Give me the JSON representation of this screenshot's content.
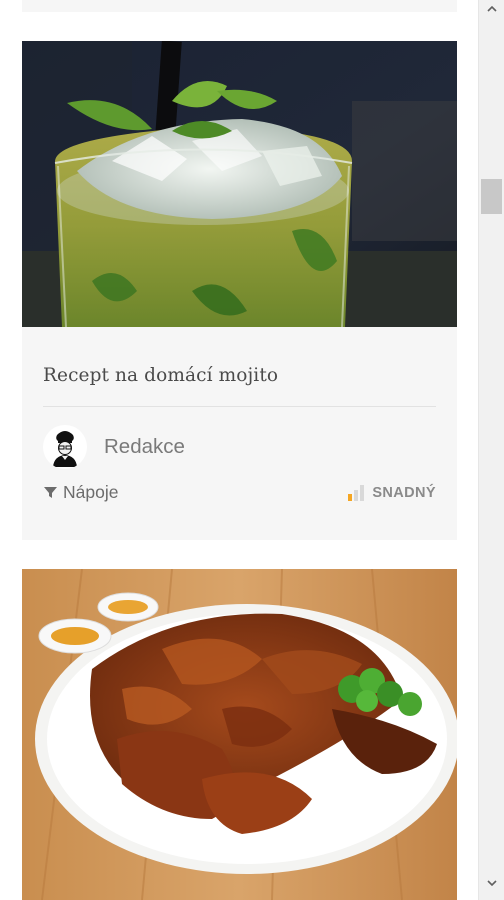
{
  "cards": [
    {
      "title": "Recept na domácí mojito",
      "author": "Redakce",
      "category": "Nápoje",
      "difficulty": "SNADNÝ",
      "image": "mojito-cocktail-photo"
    },
    {
      "image": "roast-duck-platter-photo"
    }
  ],
  "icons": {
    "category": "filter-icon",
    "difficulty": "difficulty-bars-icon",
    "author": "chef-avatar-icon"
  },
  "colors": {
    "card_background": "#f6f6f6",
    "difficulty_accent": "#f5a623",
    "text_muted": "#7a7a7a"
  }
}
